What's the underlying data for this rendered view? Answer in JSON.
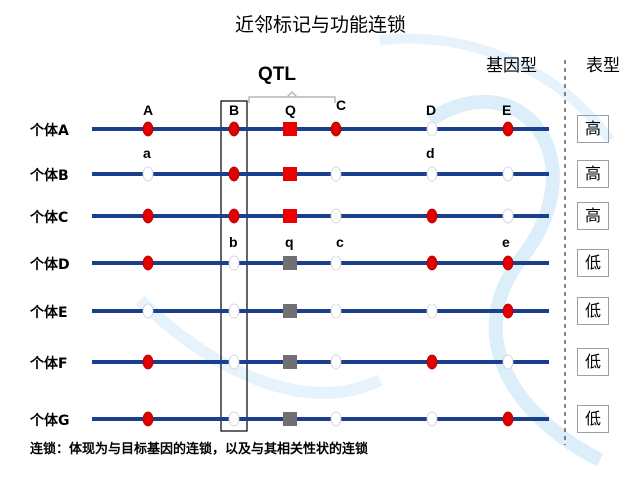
{
  "title": "近邻标记与功能连锁",
  "qtl_label": "QTL",
  "header": {
    "genotype": "基因型",
    "phenotype": "表型"
  },
  "markers_upper": [
    "A",
    "B",
    "Q",
    "C",
    "D",
    "E"
  ],
  "markers_lower": [
    "a",
    "b",
    "q",
    "c",
    "d",
    "e"
  ],
  "rows": [
    {
      "label": "个体A",
      "phenotype": "高",
      "alleles": [
        "red",
        "red",
        "red",
        "red",
        "white",
        "red"
      ]
    },
    {
      "label": "个体B",
      "phenotype": "高",
      "alleles": [
        "white",
        "red",
        "red",
        "white",
        "white",
        "white"
      ]
    },
    {
      "label": "个体C",
      "phenotype": "高",
      "alleles": [
        "red",
        "red",
        "red",
        "white",
        "red",
        "white"
      ]
    },
    {
      "label": "个体D",
      "phenotype": "低",
      "alleles": [
        "red",
        "white",
        "gray",
        "white",
        "red",
        "red"
      ]
    },
    {
      "label": "个体E",
      "phenotype": "低",
      "alleles": [
        "white",
        "white",
        "gray",
        "white",
        "white",
        "red"
      ]
    },
    {
      "label": "个体F",
      "phenotype": "低",
      "alleles": [
        "red",
        "white",
        "gray",
        "white",
        "red",
        "white"
      ]
    },
    {
      "label": "个体G",
      "phenotype": "低",
      "alleles": [
        "red",
        "white",
        "gray",
        "white",
        "white",
        "red"
      ]
    }
  ],
  "marker_labels_shown": [
    {
      "row": 0,
      "which": "upper",
      "idx": [
        0,
        1,
        2,
        3,
        4,
        5
      ]
    },
    {
      "row": 1,
      "which": "lower",
      "idx": [
        0,
        4
      ]
    },
    {
      "row": 3,
      "which": "lower",
      "idx": [
        1,
        2,
        3,
        5
      ]
    }
  ],
  "caption": "连锁：体现为与目标基因的连锁，以及与其相关性状的连锁",
  "colors": {
    "chromosome": "#1a3f8f",
    "red_allele": "#e00000",
    "white_allele": "#ffffff",
    "gray_allele": "#707070",
    "qtl_red": "#ee0000"
  }
}
